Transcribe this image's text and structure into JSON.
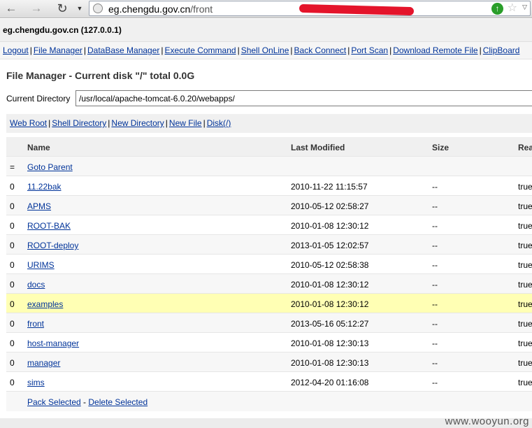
{
  "browser": {
    "url_domain": "eg.chengdu.gov.cn",
    "url_path": "/front"
  },
  "host": "eg.chengdu.gov.cn (127.0.0.1)",
  "menu": [
    "Logout",
    "File Manager",
    "DataBase Manager",
    "Execute Command",
    "Shell OnLine",
    "Back Connect",
    "Port Scan",
    "Download Remote File",
    "ClipBoard"
  ],
  "file_manager": {
    "title": "File Manager - Current disk \"/\" total 0.0G",
    "dir_label": "Current Directory",
    "dir_value": "/usr/local/apache-tomcat-6.0.20/webapps/"
  },
  "quick_links": [
    "Web Root",
    "Shell Directory",
    "New Directory",
    "New File",
    "Disk(/)"
  ],
  "table": {
    "headers": [
      "Name",
      "Last Modified",
      "Size",
      "Read"
    ],
    "parent": {
      "marker": "=",
      "label": "Goto Parent"
    },
    "rows": [
      {
        "sel": "0",
        "name": "11.22bak",
        "modified": "2010-11-22 11:15:57",
        "size": "--",
        "read": "true"
      },
      {
        "sel": "0",
        "name": "APMS",
        "modified": "2010-05-12 02:58:27",
        "size": "--",
        "read": "true"
      },
      {
        "sel": "0",
        "name": "ROOT-BAK",
        "modified": "2010-01-08 12:30:12",
        "size": "--",
        "read": "true"
      },
      {
        "sel": "0",
        "name": "ROOT-deploy",
        "modified": "2013-01-05 12:02:57",
        "size": "--",
        "read": "true"
      },
      {
        "sel": "0",
        "name": "URIMS",
        "modified": "2010-05-12 02:58:38",
        "size": "--",
        "read": "true"
      },
      {
        "sel": "0",
        "name": "docs",
        "modified": "2010-01-08 12:30:12",
        "size": "--",
        "read": "true"
      },
      {
        "sel": "0",
        "name": "examples",
        "modified": "2010-01-08 12:30:12",
        "size": "--",
        "read": "true"
      },
      {
        "sel": "0",
        "name": "front",
        "modified": "2013-05-16 05:12:27",
        "size": "--",
        "read": "true"
      },
      {
        "sel": "0",
        "name": "host-manager",
        "modified": "2010-01-08 12:30:13",
        "size": "--",
        "read": "true"
      },
      {
        "sel": "0",
        "name": "manager",
        "modified": "2010-01-08 12:30:13",
        "size": "--",
        "read": "true"
      },
      {
        "sel": "0",
        "name": "sims",
        "modified": "2012-04-20 01:16:08",
        "size": "--",
        "read": "true"
      }
    ],
    "footer": {
      "pack": "Pack Selected",
      "dash": " - ",
      "delete": "Delete Selected"
    }
  },
  "watermark": "www.wooyun.org"
}
